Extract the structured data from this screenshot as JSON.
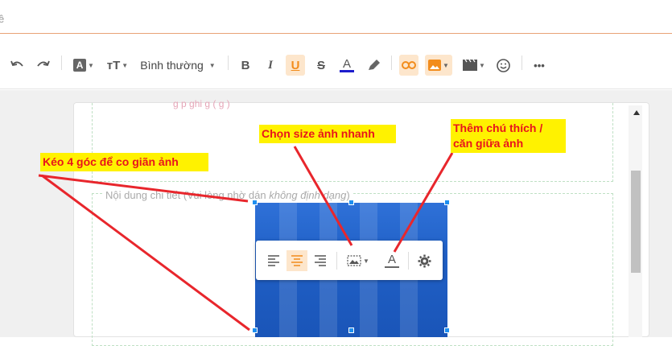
{
  "breadcrumb": "ề",
  "toolbar": {
    "undo_icon": "undo-icon",
    "redo_icon": "redo-icon",
    "text_color_glyph": "A",
    "font_size_glyph": "тT",
    "paragraph_style": "Bình thường",
    "bold": "B",
    "italic": "I",
    "underline": "U",
    "strike": "S",
    "font_color": "A",
    "accent_color": "#f28c1c",
    "font_color_bar": "#1d1dcc"
  },
  "editor": {
    "field1_ghost": "g   p   ghi    g    (     g )",
    "field2_label_prefix": "Nội dung chi tiết",
    "field2_label_hint": "(Vui lòng nhờ dán",
    "field2_label_hint_italic": "không định dạng",
    "field2_label_suffix": ")"
  },
  "image_toolbar": {
    "align_left": "align-left-icon",
    "align_center": "align-center-icon",
    "align_right": "align-right-icon",
    "size": "image-size-icon",
    "caption": "A",
    "settings": "gear-icon"
  },
  "callouts": {
    "resize": "Kéo 4 góc để co giãn ảnh",
    "size": "Chọn size ảnh nhanh",
    "caption_line1": "Thêm chú thích /",
    "caption_line2": "căn giữa ảnh"
  }
}
